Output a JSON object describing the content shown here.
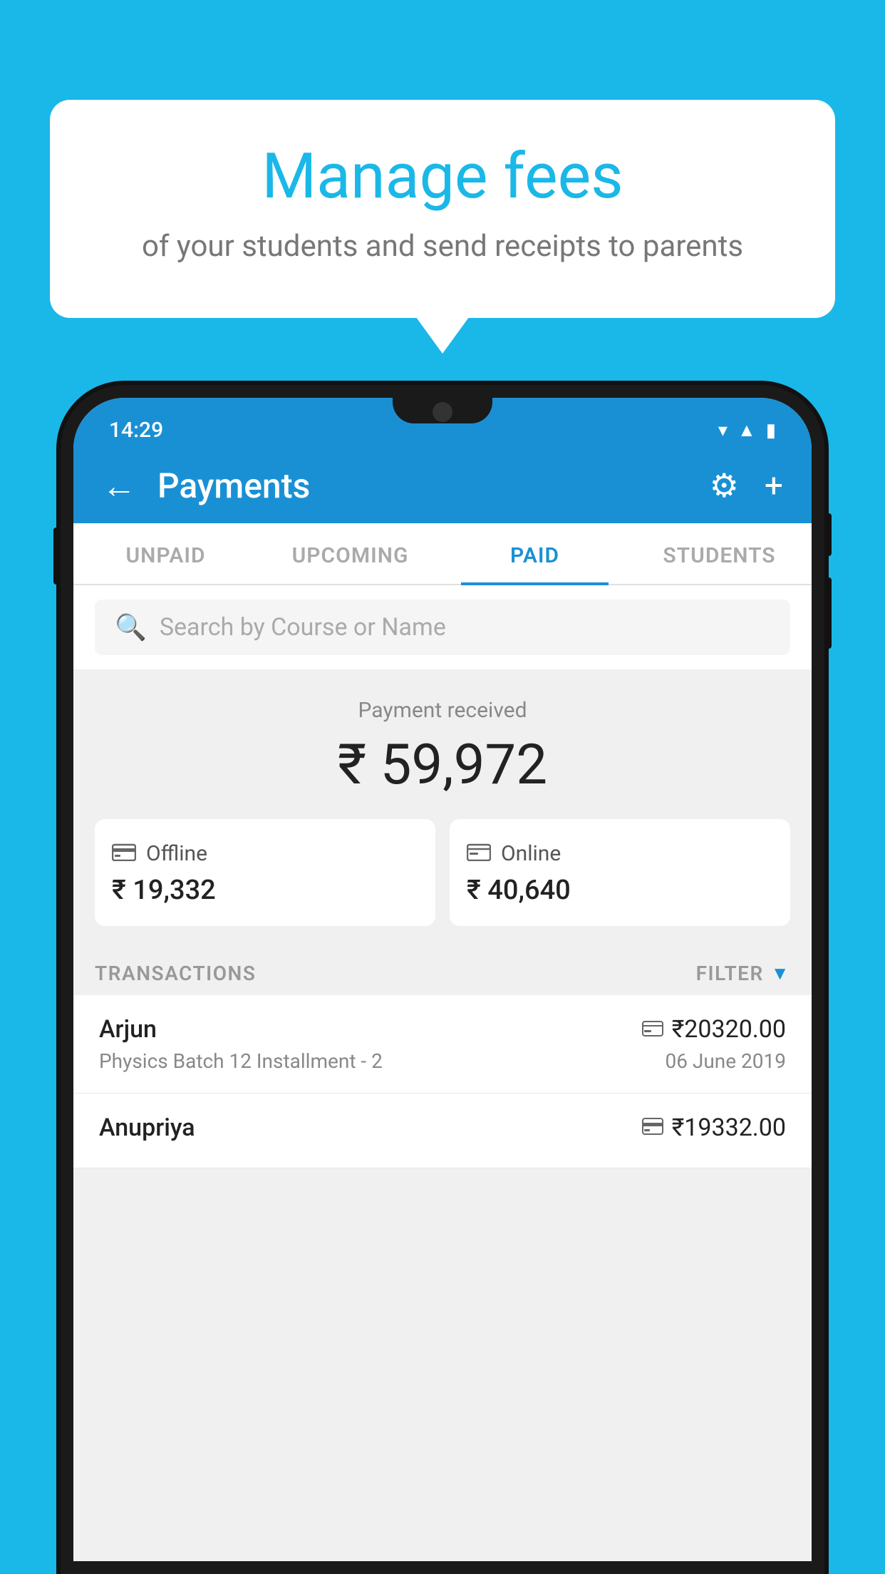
{
  "background": {
    "color": "#1ab8e8"
  },
  "speech_bubble": {
    "title": "Manage fees",
    "subtitle": "of your students and send receipts to parents"
  },
  "status_bar": {
    "time": "14:29",
    "wifi_icon": "▾",
    "signal_icon": "▲",
    "battery_icon": "▮"
  },
  "header": {
    "back_icon": "←",
    "title": "Payments",
    "gear_icon": "⚙",
    "plus_icon": "+"
  },
  "tabs": [
    {
      "label": "UNPAID",
      "active": false
    },
    {
      "label": "UPCOMING",
      "active": false
    },
    {
      "label": "PAID",
      "active": true
    },
    {
      "label": "STUDENTS",
      "active": false
    }
  ],
  "search": {
    "placeholder": "Search by Course or Name",
    "icon": "🔍"
  },
  "payment_summary": {
    "label": "Payment received",
    "amount": "₹ 59,972",
    "offline": {
      "label": "Offline",
      "amount": "₹ 19,332",
      "icon": "💳"
    },
    "online": {
      "label": "Online",
      "amount": "₹ 40,640",
      "icon": "💳"
    }
  },
  "transactions": {
    "header_label": "TRANSACTIONS",
    "filter_label": "FILTER",
    "items": [
      {
        "name": "Arjun",
        "course": "Physics Batch 12 Installment - 2",
        "amount": "₹20320.00",
        "date": "06 June 2019",
        "type": "online"
      },
      {
        "name": "Anupriya",
        "course": "",
        "amount": "₹19332.00",
        "date": "",
        "type": "offline"
      }
    ]
  }
}
